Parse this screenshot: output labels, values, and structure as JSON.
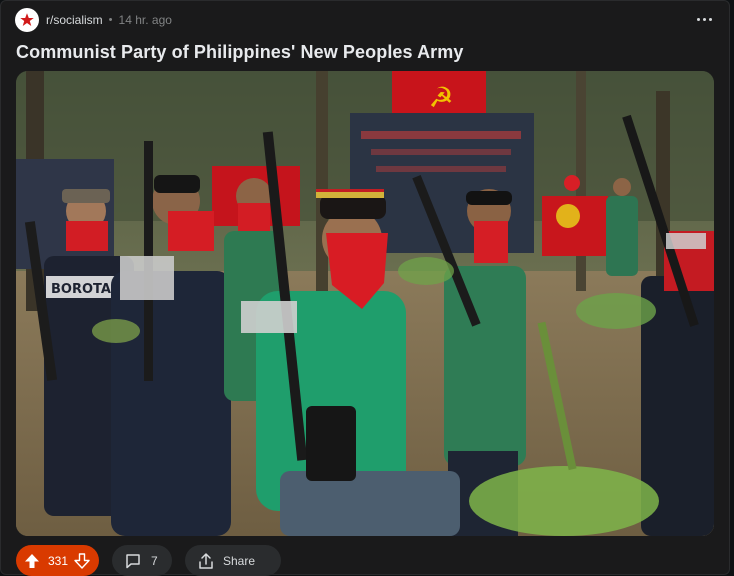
{
  "post": {
    "subreddit": "r/socialism",
    "separator": "•",
    "time": "14 hr. ago",
    "title": "Communist Party of Philippines' New Peoples Army"
  },
  "photo": {
    "shirt_text": "BOROTAK"
  },
  "actions": {
    "upvotes": "331",
    "comments": "7",
    "share_label": "Share"
  },
  "colors": {
    "vote_accent": "#d93a00",
    "card_bg": "#1a1a1b",
    "pill_bg": "#2a2c2e"
  }
}
